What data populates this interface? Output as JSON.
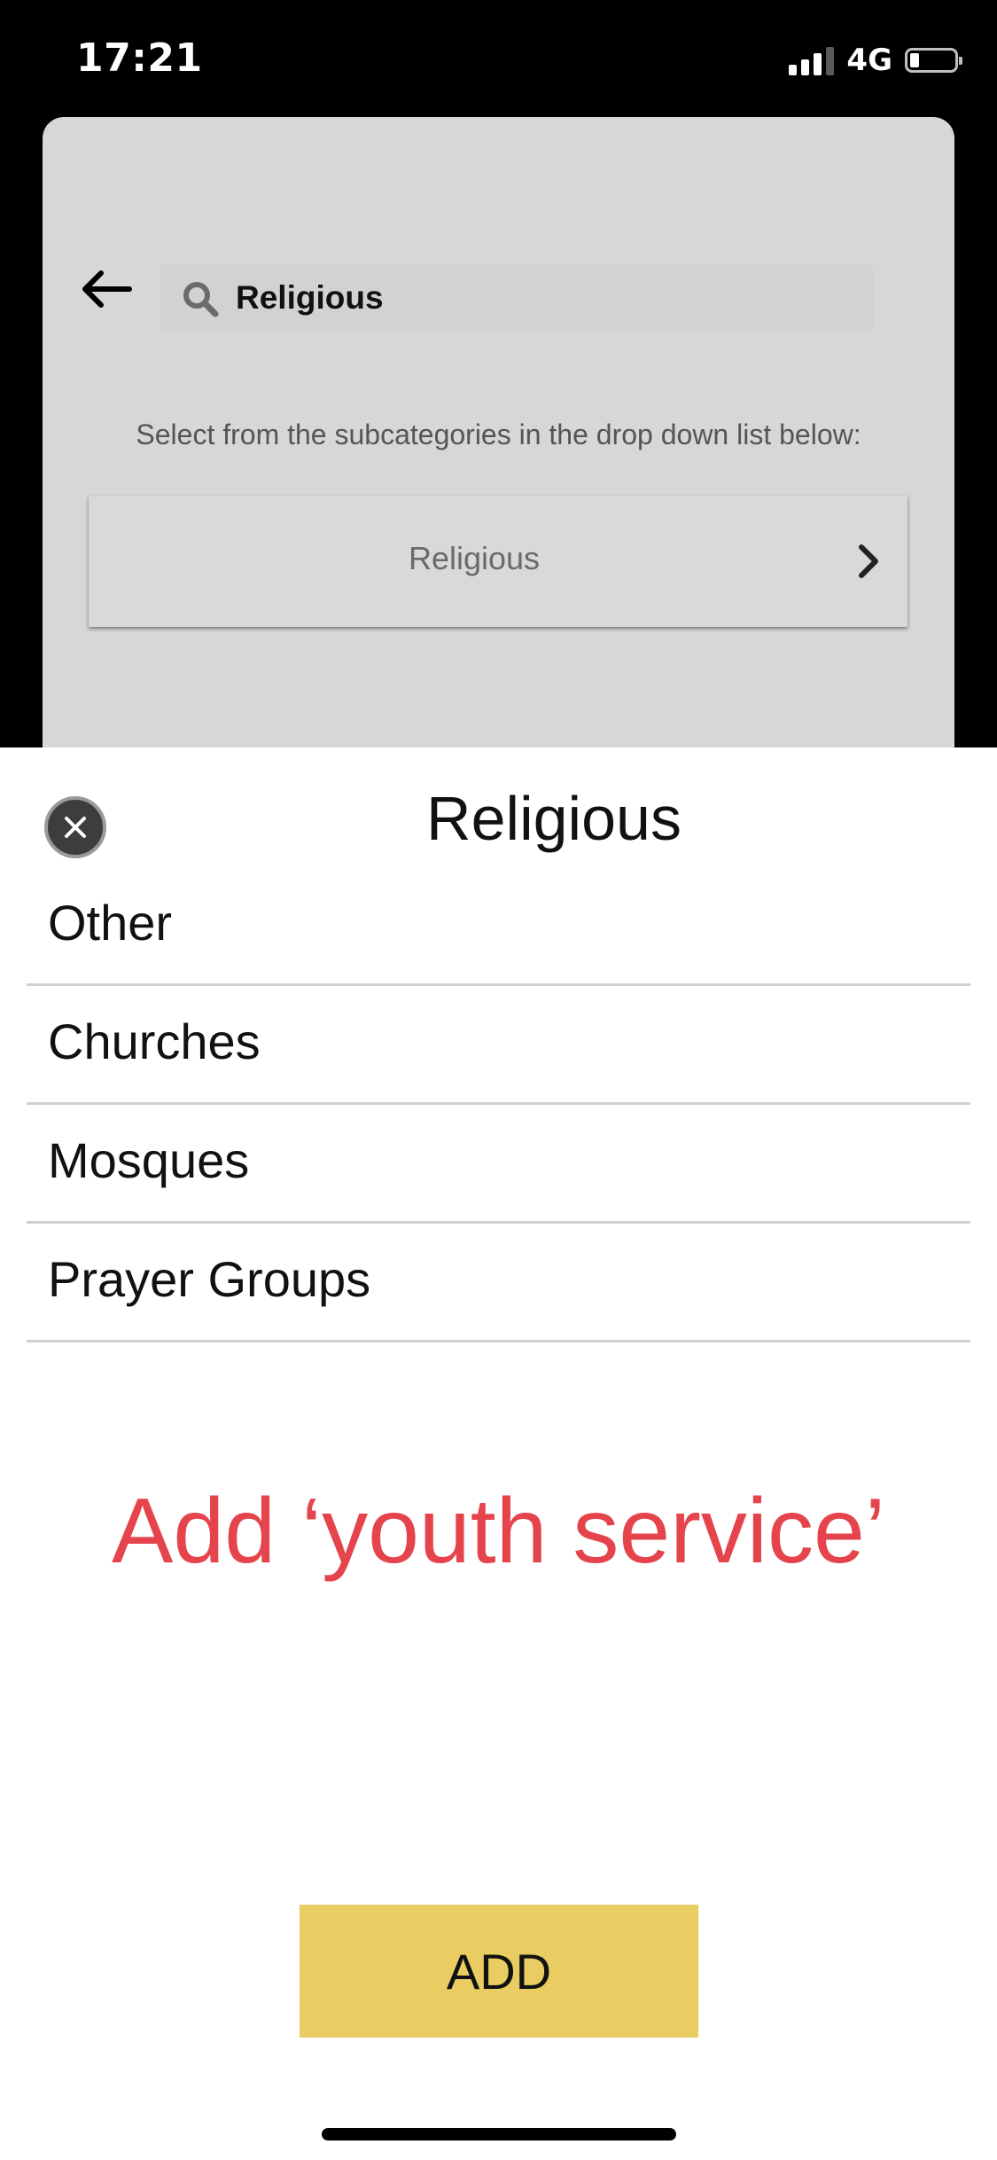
{
  "status_bar": {
    "time": "17:21",
    "network": "4G",
    "signal_bars_filled": 3,
    "signal_bars_total": 4,
    "battery_level": 0.15
  },
  "background_screen": {
    "search": {
      "query": "Religious",
      "icon": "search-icon"
    },
    "back_icon": "back-arrow-icon",
    "instruction": "Select from the subcategories in the drop down list below:",
    "dropdown": {
      "value": "Religious",
      "icon": "chevron-right-icon"
    }
  },
  "sheet": {
    "title": "Religious",
    "close_icon": "close-icon",
    "options": [
      {
        "label": "Other"
      },
      {
        "label": "Churches"
      },
      {
        "label": "Mosques"
      },
      {
        "label": "Prayer Groups"
      }
    ],
    "annotation": "Add ‘youth service’",
    "add_button_label": "ADD"
  },
  "colors": {
    "add_button": "#e9cd62",
    "annotation_text": "#e5444d",
    "overlay_card": "#d7d7d7",
    "close_button": "#3d3d3d"
  }
}
